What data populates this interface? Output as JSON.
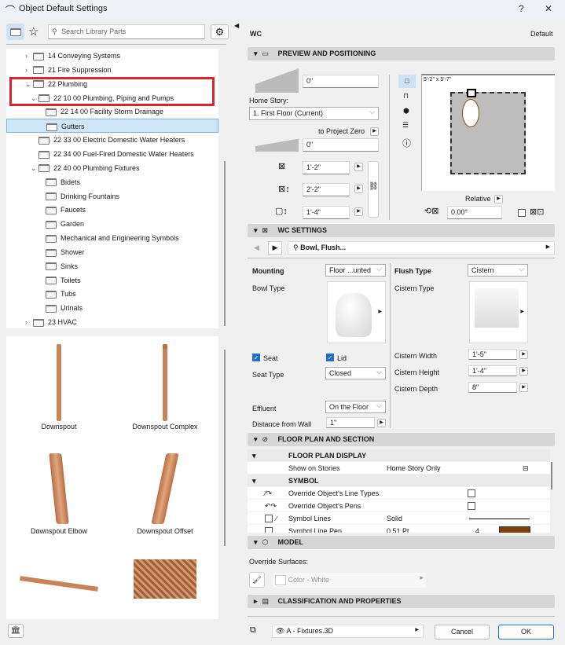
{
  "window": {
    "title": "Object Default Settings",
    "help": "?",
    "close": "✕"
  },
  "left": {
    "search_placeholder": "Search Library Parts",
    "tree": [
      {
        "label": "14 Conveying Systems",
        "level": 0,
        "chevron": "›"
      },
      {
        "label": "21 Fire Suppression",
        "level": 0,
        "chevron": "›"
      },
      {
        "label": "22 Plumbing",
        "level": 0,
        "chevron": "⌄"
      },
      {
        "label": "22 10 00 Plumbing, Piping and Pumps",
        "level": 1,
        "chevron": "⌄"
      },
      {
        "label": "22 14 00 Facility Storm Drainage",
        "level": 2,
        "chevron": ""
      },
      {
        "label": "Gutters",
        "level": 2,
        "chevron": "",
        "selected": true
      },
      {
        "label": "22 33 00 Electric Domestic Water Heaters",
        "level": 1,
        "chevron": ""
      },
      {
        "label": "22 34 00 Fuel-Fired Domestic Water Heaters",
        "level": 1,
        "chevron": ""
      },
      {
        "label": "22 40 00 Plumbing Fixtures",
        "level": 1,
        "chevron": "⌄"
      },
      {
        "label": "Bidets",
        "level": 2,
        "chevron": ""
      },
      {
        "label": "Drinking Fountains",
        "level": 2,
        "chevron": ""
      },
      {
        "label": "Faucets",
        "level": 2,
        "chevron": ""
      },
      {
        "label": "Garden",
        "level": 2,
        "chevron": ""
      },
      {
        "label": "Mechanical and Engineering Symbols",
        "level": 2,
        "chevron": ""
      },
      {
        "label": "Shower",
        "level": 2,
        "chevron": ""
      },
      {
        "label": "Sinks",
        "level": 2,
        "chevron": ""
      },
      {
        "label": "Toilets",
        "level": 2,
        "chevron": ""
      },
      {
        "label": "Tubs",
        "level": 2,
        "chevron": ""
      },
      {
        "label": "Urinals",
        "level": 2,
        "chevron": ""
      },
      {
        "label": "23 HVAC",
        "level": 0,
        "chevron": "›"
      }
    ],
    "gallery": [
      "Downspout",
      "Downspout Complex",
      "Downspout Elbow",
      "Downspout Offset",
      "",
      ""
    ]
  },
  "right": {
    "object_name": "WC",
    "default_label": "Default",
    "preview": {
      "header": "PREVIEW AND POSITIONING",
      "elev_top": "0\"",
      "home_story_label": "Home Story:",
      "home_story": "1. First Floor (Current)",
      "to_project_zero": "to Project Zero",
      "elev_zero": "0\"",
      "width": "1'-2\"",
      "depth": "2'-2\"",
      "height": "1'-4\"",
      "dims": "5'-2\" x 5'-7\"",
      "relative": "Relative",
      "angle": "0.00°"
    },
    "wc": {
      "header": "WC SETTINGS",
      "nav_label": "Bowl, Flush...",
      "mounting_label": "Mounting",
      "mounting": "Floor ...unted",
      "bowl_type_label": "Bowl Type",
      "seat_label": "Seat",
      "lid_label": "Lid",
      "seat_type_label": "Seat Type",
      "seat_type": "Closed",
      "effluent_label": "Effluent",
      "effluent": "On the Floor",
      "dist_label": "Distance from Wall",
      "dist": "1\"",
      "flush_type_label": "Flush Type",
      "flush_type": "Cistern",
      "cistern_type_label": "Cistern Type",
      "cw_label": "Cistern Width",
      "cw": "1'-5\"",
      "ch_label": "Cistern Height",
      "ch": "1'-4\"",
      "cd_label": "Cistern Depth",
      "cd": "8\""
    },
    "floorplan": {
      "header": "FLOOR PLAN AND SECTION",
      "display": "FLOOR PLAN DISPLAY",
      "show_label": "Show on Stories",
      "show_value": "Home Story Only",
      "symbol": "SYMBOL",
      "line_types": "Override Object's Line Types",
      "pens": "Override Object's Pens",
      "sym_lines": "Symbol Lines",
      "sym_lines_value": "Solid",
      "sym_pen": "Symbol Line Pen",
      "sym_pen_value": "0.51 Pt",
      "sym_pen_num": "4",
      "pen_color": "#7a3e0a"
    },
    "model": {
      "header": "MODEL",
      "override_label": "Override Surfaces:",
      "surface": "Color - White"
    },
    "classification": {
      "header": "CLASSIFICATION AND PROPERTIES"
    },
    "footer": {
      "layer": "A - Fixtures.3D",
      "cancel": "Cancel",
      "ok": "OK"
    }
  },
  "colors": {
    "highlight": "#d9262e",
    "selection": "#cfe6f8",
    "accent": "#1e6fc8"
  }
}
